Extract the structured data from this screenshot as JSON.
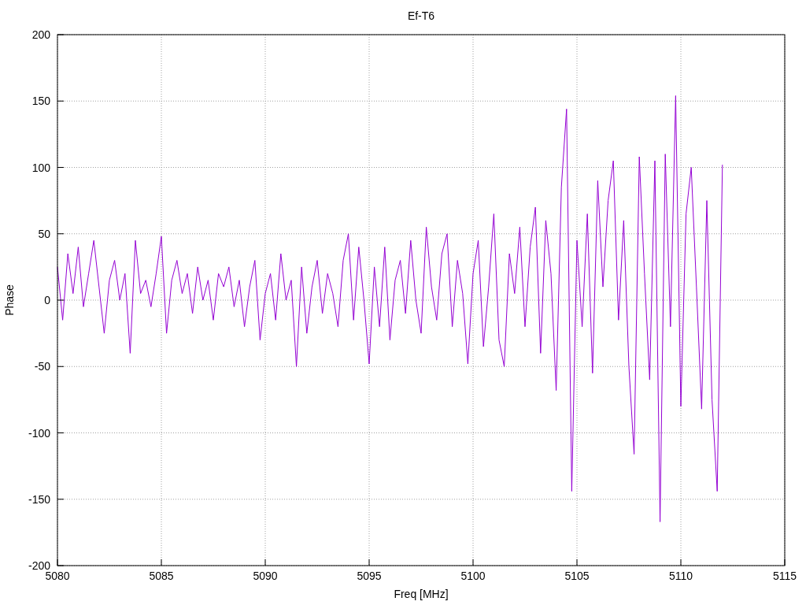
{
  "chart_data": {
    "type": "line",
    "title": "Ef-T6",
    "xlabel": "Freq [MHz]",
    "ylabel": "Phase",
    "xlim": [
      5080,
      5115
    ],
    "ylim": [
      -200,
      200
    ],
    "xticks": [
      5080,
      5085,
      5090,
      5095,
      5100,
      5105,
      5110,
      5115
    ],
    "yticks": [
      -200,
      -150,
      -100,
      -50,
      0,
      50,
      100,
      150,
      200
    ],
    "grid": true,
    "x": [
      5080,
      5080.25,
      5080.5,
      5080.75,
      5081,
      5081.25,
      5081.5,
      5081.75,
      5082,
      5082.25,
      5082.5,
      5082.75,
      5083,
      5083.25,
      5083.5,
      5083.75,
      5084,
      5084.25,
      5084.5,
      5084.75,
      5085,
      5085.25,
      5085.5,
      5085.75,
      5086,
      5086.25,
      5086.5,
      5086.75,
      5087,
      5087.25,
      5087.5,
      5087.75,
      5088,
      5088.25,
      5088.5,
      5088.75,
      5089,
      5089.25,
      5089.5,
      5089.75,
      5090,
      5090.25,
      5090.5,
      5090.75,
      5091,
      5091.25,
      5091.5,
      5091.75,
      5092,
      5092.25,
      5092.5,
      5092.75,
      5093,
      5093.25,
      5093.5,
      5093.75,
      5094,
      5094.25,
      5094.5,
      5094.75,
      5095,
      5095.25,
      5095.5,
      5095.75,
      5096,
      5096.25,
      5096.5,
      5096.75,
      5097,
      5097.25,
      5097.5,
      5097.75,
      5098,
      5098.25,
      5098.5,
      5098.75,
      5099,
      5099.25,
      5099.5,
      5099.75,
      5100,
      5100.25,
      5100.5,
      5100.75,
      5101,
      5101.25,
      5101.5,
      5101.75,
      5102,
      5102.25,
      5102.5,
      5102.75,
      5103,
      5103.25,
      5103.5,
      5103.75,
      5104,
      5104.25,
      5104.5,
      5104.75,
      5105,
      5105.25,
      5105.5,
      5105.75,
      5106,
      5106.25,
      5106.5,
      5106.75,
      5107,
      5107.25,
      5107.5,
      5107.75,
      5108,
      5108.25,
      5108.5,
      5108.75,
      5109,
      5109.25,
      5109.5,
      5109.75,
      5110,
      5110.25,
      5110.5,
      5110.75,
      5111,
      5111.25,
      5111.5,
      5111.75,
      5112
    ],
    "series": [
      {
        "color": "#9400d3",
        "values": [
          25,
          -15,
          35,
          5,
          40,
          -5,
          20,
          45,
          10,
          -25,
          15,
          30,
          0,
          20,
          -40,
          45,
          5,
          15,
          -5,
          20,
          48,
          -25,
          15,
          30,
          5,
          20,
          -10,
          25,
          0,
          15,
          -15,
          20,
          10,
          25,
          -5,
          15,
          -20,
          10,
          30,
          -30,
          5,
          20,
          -15,
          35,
          0,
          15,
          -50,
          25,
          -25,
          10,
          30,
          -10,
          20,
          5,
          -20,
          30,
          50,
          -15,
          40,
          0,
          -48,
          25,
          -20,
          40,
          -30,
          15,
          30,
          -10,
          45,
          0,
          -25,
          55,
          10,
          -15,
          35,
          50,
          -20,
          30,
          5,
          -48,
          20,
          45,
          -35,
          10,
          65,
          -30,
          -50,
          35,
          5,
          55,
          -20,
          40,
          70,
          -40,
          60,
          20,
          -68,
          85,
          144,
          -144,
          45,
          -20,
          65,
          -55,
          90,
          10,
          75,
          105,
          -15,
          60,
          -50,
          -116,
          108,
          20,
          -60,
          105,
          -167,
          110,
          -20,
          154,
          -80,
          65,
          100,
          10,
          -82,
          75,
          -75,
          -144,
          102
        ]
      }
    ]
  }
}
